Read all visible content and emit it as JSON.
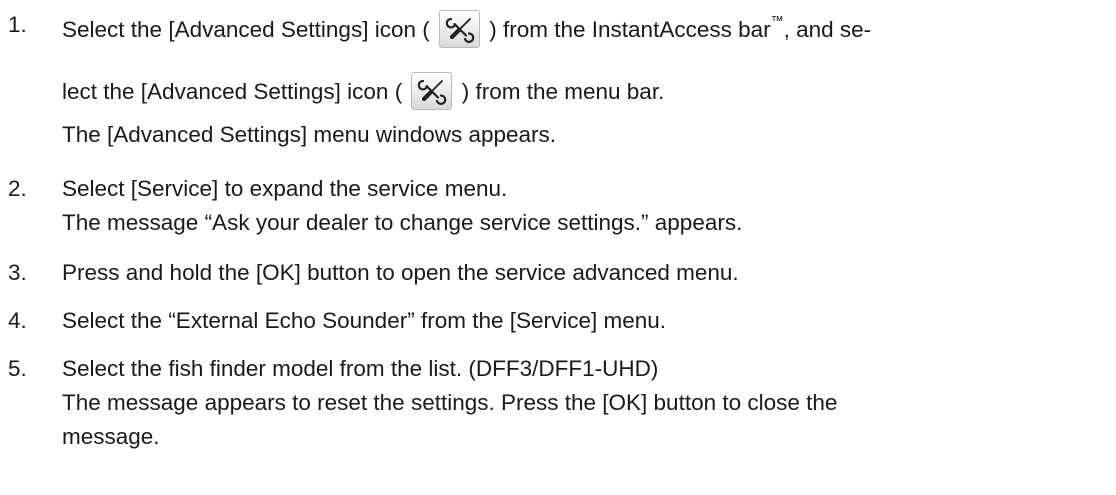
{
  "steps": [
    {
      "number": "1.",
      "line1_a": "Select the [Advanced Settings] icon (",
      "line1_b": ") from the InstantAccess bar",
      "trademark": "™",
      "line1_c": ", and se-",
      "line2_a": "lect the [Advanced Settings] icon (",
      "line2_b": ") from the menu bar.",
      "line3": "The [Advanced Settings] menu windows appears."
    },
    {
      "number": "2.",
      "line1": "Select [Service] to expand the service menu.",
      "line2": "The message “Ask your dealer to change service settings.” appears."
    },
    {
      "number": "3.",
      "line1": "Press and hold the [OK] button to open the service advanced menu."
    },
    {
      "number": "4.",
      "line1": "Select the “External Echo Sounder” from the [Service] menu."
    },
    {
      "number": "5.",
      "line1": "Select the fish finder model from the list. (DFF3/DFF1-UHD)",
      "line2": "The message appears to reset the settings. Press the [OK] button to close the",
      "line3": "message."
    }
  ],
  "icon_name": "wrench-screwdriver-icon"
}
